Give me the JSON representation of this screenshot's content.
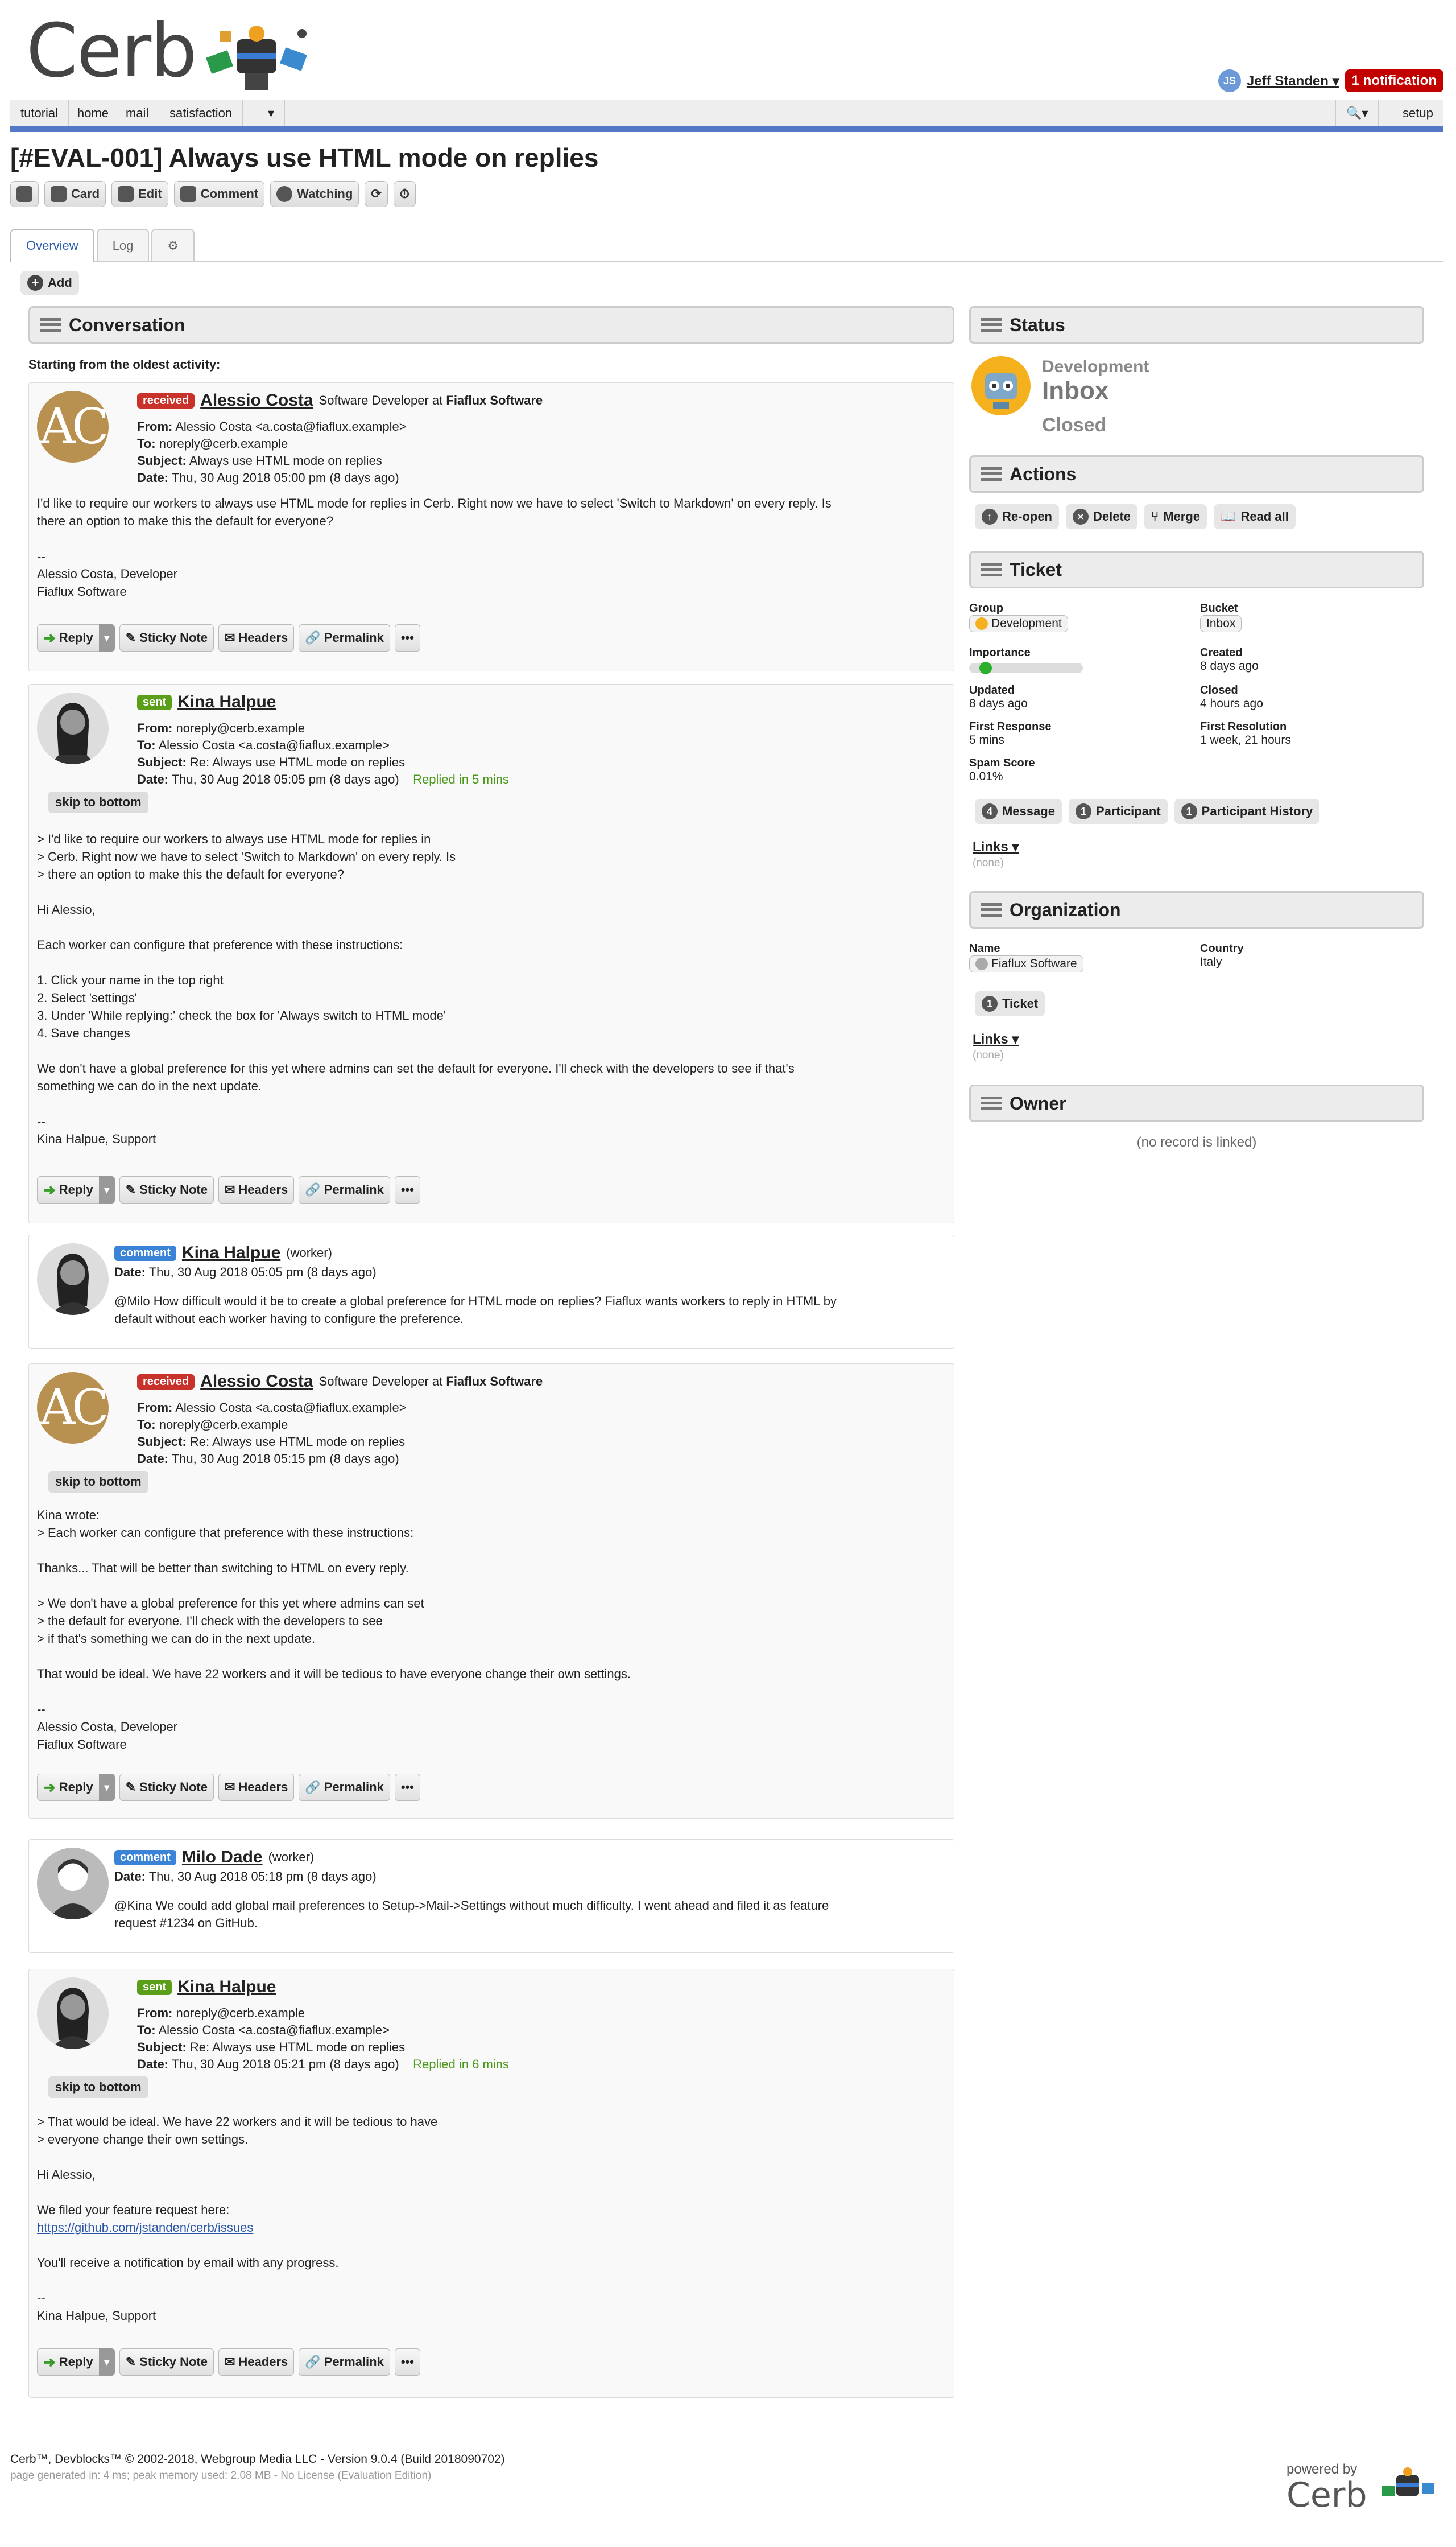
{
  "app": {
    "logo": "Cerb"
  },
  "user": {
    "initials": "JS",
    "name": "Jeff Standen ▾",
    "notifications": "1 notification"
  },
  "nav": {
    "items": [
      "tutorial",
      "home",
      "mail",
      "satisfaction"
    ],
    "more": "▾",
    "search": "🔍▾",
    "setup": "setup"
  },
  "ticket": {
    "title": "[#EVAL-001] Always use HTML mode on replies"
  },
  "toolbar": {
    "card": "Card",
    "edit": "Edit",
    "comment": "Comment",
    "watching": "Watching"
  },
  "tabs": {
    "overview": "Overview",
    "log": "Log",
    "settings": "⚙"
  },
  "add": {
    "label": "Add"
  },
  "conversation": {
    "title": "Conversation",
    "subtitle": "Starting from the oldest activity:",
    "skip": "skip to bottom",
    "actions": {
      "reply": "Reply",
      "sticky": "Sticky Note",
      "headers": "Headers",
      "permalink": "Permalink",
      "more": "•••"
    },
    "messages": [
      {
        "badge": "received",
        "name": "Alessio Costa",
        "role": "Software Developer at",
        "org": "Fiaflux Software",
        "from": "Alessio Costa <a.costa@fiaflux.example>",
        "to": "noreply@cerb.example",
        "subject": "Always use HTML mode on replies",
        "date": "Thu, 30 Aug 2018 05:00 pm (8 days ago)",
        "body": "I'd like to require our workers to always use HTML mode for replies in Cerb. Right now we have to select 'Switch to Markdown' on every reply. Is\nthere an option to make this the default for everyone?\n\n--\nAlessio Costa, Developer\nFiaflux Software"
      },
      {
        "badge": "sent",
        "name": "Kina Halpue",
        "from": "noreply@cerb.example",
        "to": "Alessio Costa <a.costa@fiaflux.example>",
        "subject": "Re: Always use HTML mode on replies",
        "date": "Thu, 30 Aug 2018 05:05 pm (8 days ago)",
        "replied": "Replied in 5 mins",
        "body": "> I'd like to require our workers to always use HTML mode for replies in\n> Cerb. Right now we have to select 'Switch to Markdown' on every reply. Is\n> there an option to make this the default for everyone?\n\nHi Alessio,\n\nEach worker can configure that preference with these instructions:\n\n1. Click your name in the top right\n2. Select 'settings'\n3. Under 'While replying:' check the box for 'Always switch to HTML mode'\n4. Save changes\n\nWe don't have a global preference for this yet where admins can set the default for everyone. I'll check with the developers to see if that's\nsomething we can do in the next update.\n\n--\nKina Halpue, Support"
      },
      {
        "badge": "comment",
        "name": "Kina Halpue",
        "role": "(worker)",
        "date": "Thu, 30 Aug 2018 05:05 pm (8 days ago)",
        "body": "@Milo How difficult would it be to create a global preference for HTML mode on replies? Fiaflux wants workers to reply in HTML by\ndefault without each worker having to configure the preference."
      },
      {
        "badge": "received",
        "name": "Alessio Costa",
        "role": "Software Developer at",
        "org": "Fiaflux Software",
        "from": "Alessio Costa <a.costa@fiaflux.example>",
        "to": "noreply@cerb.example",
        "subject": "Re: Always use HTML mode on replies",
        "date": "Thu, 30 Aug 2018 05:15 pm (8 days ago)",
        "body": "Kina wrote:\n> Each worker can configure that preference with these instructions:\n\nThanks... That will be better than switching to HTML on every reply.\n\n> We don't have a global preference for this yet where admins can set\n> the default for everyone. I'll check with the developers to see\n> if that's something we can do in the next update.\n\nThat would be ideal. We have 22 workers and it will be tedious to have everyone change their own settings.\n\n--\nAlessio Costa, Developer\nFiaflux Software"
      },
      {
        "badge": "comment",
        "name": "Milo Dade",
        "role": "(worker)",
        "date": "Thu, 30 Aug 2018 05:18 pm (8 days ago)",
        "body": "@Kina We could add global mail preferences to Setup->Mail->Settings without much difficulty. I went ahead and filed it as feature\nrequest #1234 on GitHub."
      },
      {
        "badge": "sent",
        "name": "Kina Halpue",
        "from": "noreply@cerb.example",
        "to": "Alessio Costa <a.costa@fiaflux.example>",
        "subject": "Re: Always use HTML mode on replies",
        "date": "Thu, 30 Aug 2018 05:21 pm (8 days ago)",
        "replied": "Replied in 6 mins",
        "body_top": "> That would be ideal. We have 22 workers and it will be tedious to have\n> everyone change their own settings.\n\nHi Alessio,\n\nWe filed your feature request here:",
        "link": "https://github.com/jstanden/cerb/issues",
        "body_bottom": "\nYou'll receive a notification by email with any progress.\n\n--\nKina Halpue, Support"
      }
    ]
  },
  "status": {
    "title": "Status",
    "group": "Development",
    "bucket": "Inbox",
    "state": "Closed"
  },
  "actions_panel": {
    "title": "Actions",
    "reopen": "Re-open",
    "delete": "Delete",
    "merge": "Merge",
    "readall": "Read all"
  },
  "ticket_panel": {
    "title": "Ticket",
    "fields": {
      "group_l": "Group",
      "group_v": "Development",
      "bucket_l": "Bucket",
      "bucket_v": "Inbox",
      "importance_l": "Importance",
      "created_l": "Created",
      "created_v": "8 days ago",
      "updated_l": "Updated",
      "updated_v": "8 days ago",
      "closed_l": "Closed",
      "closed_v": "4 hours ago",
      "first_response_l": "First Response",
      "first_response_v": "5 mins",
      "first_resolution_l": "First Resolution",
      "first_resolution_v": "1 week, 21 hours",
      "spam_l": "Spam Score",
      "spam_v": "0.01%"
    },
    "importance": 0.1,
    "buttons": [
      {
        "count": "4",
        "label": "Message"
      },
      {
        "count": "1",
        "label": "Participant"
      },
      {
        "count": "1",
        "label": "Participant History"
      }
    ],
    "links": "Links ▾",
    "none": "(none)"
  },
  "org_panel": {
    "title": "Organization",
    "name_l": "Name",
    "name_v": "Fiaflux Software",
    "country_l": "Country",
    "country_v": "Italy",
    "ticket_count": "1",
    "ticket_label": "Ticket",
    "links": "Links ▾",
    "none": "(none)"
  },
  "owner_panel": {
    "title": "Owner",
    "empty": "(no record is linked)"
  },
  "footer": {
    "line1": "Cerb™, Devblocks™ © 2002-2018, Webgroup Media LLC - Version 9.0.4 (Build 2018090702)",
    "line2": "page generated in: 4 ms; peak memory used: 2.08 MB - No License (Evaluation Edition)",
    "powered": "powered by",
    "powered_logo": "Cerb"
  }
}
